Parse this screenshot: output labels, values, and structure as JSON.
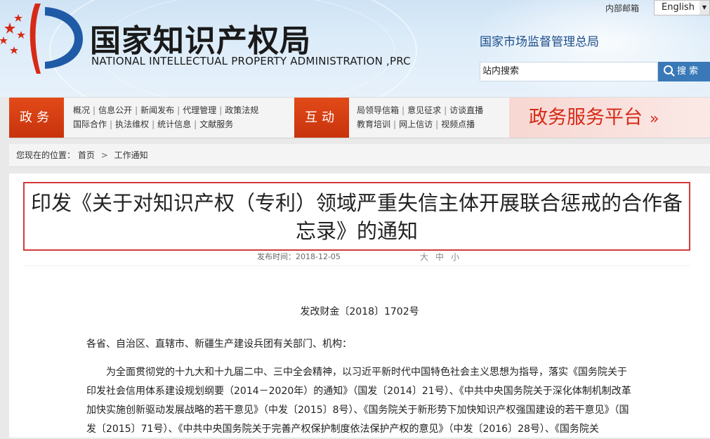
{
  "header": {
    "title_cn": "国家知识产权局",
    "title_en": "NATIONAL INTELLECTUAL PROPERTY ADMINISTRATION ,PRC",
    "parent_org": "国家市场监督管理总局",
    "internal_mail": "内部邮箱",
    "language": "English",
    "search_placeholder": "站内搜索",
    "search_button": "搜 索"
  },
  "nav": {
    "gov_affairs": {
      "label": "政务",
      "row1": [
        "概况",
        "信息公开",
        "新闻发布",
        "代理管理",
        "政策法规"
      ],
      "row2": [
        "国际合作",
        "执法维权",
        "统计信息",
        "文献服务"
      ]
    },
    "interaction": {
      "label": "互动",
      "row1": [
        "局领导信箱",
        "意见征求",
        "访谈直播"
      ],
      "row2": [
        "教育培训",
        "网上信访",
        "视频点播"
      ]
    },
    "service_platform": "政务服务平台",
    "service_arrow": "»"
  },
  "breadcrumb": {
    "prefix": "您现在的位置：",
    "home": "首页",
    "current": "工作通知",
    "separator": ">"
  },
  "article": {
    "title": "印发《关于对知识产权（专利）领域严重失信主体开展联合惩戒的合作备忘录》的通知",
    "publish_label": "发布时间：",
    "publish_date": "2018-12-05",
    "font_sizes": [
      "大",
      "中",
      "小"
    ],
    "doc_number": "发改财金〔2018〕1702号",
    "salutation": "各省、自治区、直辖市、新疆生产建设兵团有关部门、机构：",
    "paragraph1": "为全面贯彻党的十九大和十九届二中、三中全会精神，以习近平新时代中国特色社会主义思想为指导，落实《国务院关于印发社会信用体系建设规划纲要（2014－2020年）的通知》（国发〔2014〕21号）、《中共中央国务院关于深化体制机制改革加快实施创新驱动发展战略的若干意见》（中发〔2015〕8号）、《国务院关于新形势下加快知识产权强国建设的若干意见》（国发〔2015〕71号）、《中共中央国务院关于完善产权保护制度依法保护产权的意见》（中发〔2016〕28号）、《国务院关"
  },
  "colors": {
    "nav_red": "#d13a10",
    "title_border": "#d33a3a",
    "search_blue": "#3a79b8",
    "service_text": "#d62a17"
  }
}
